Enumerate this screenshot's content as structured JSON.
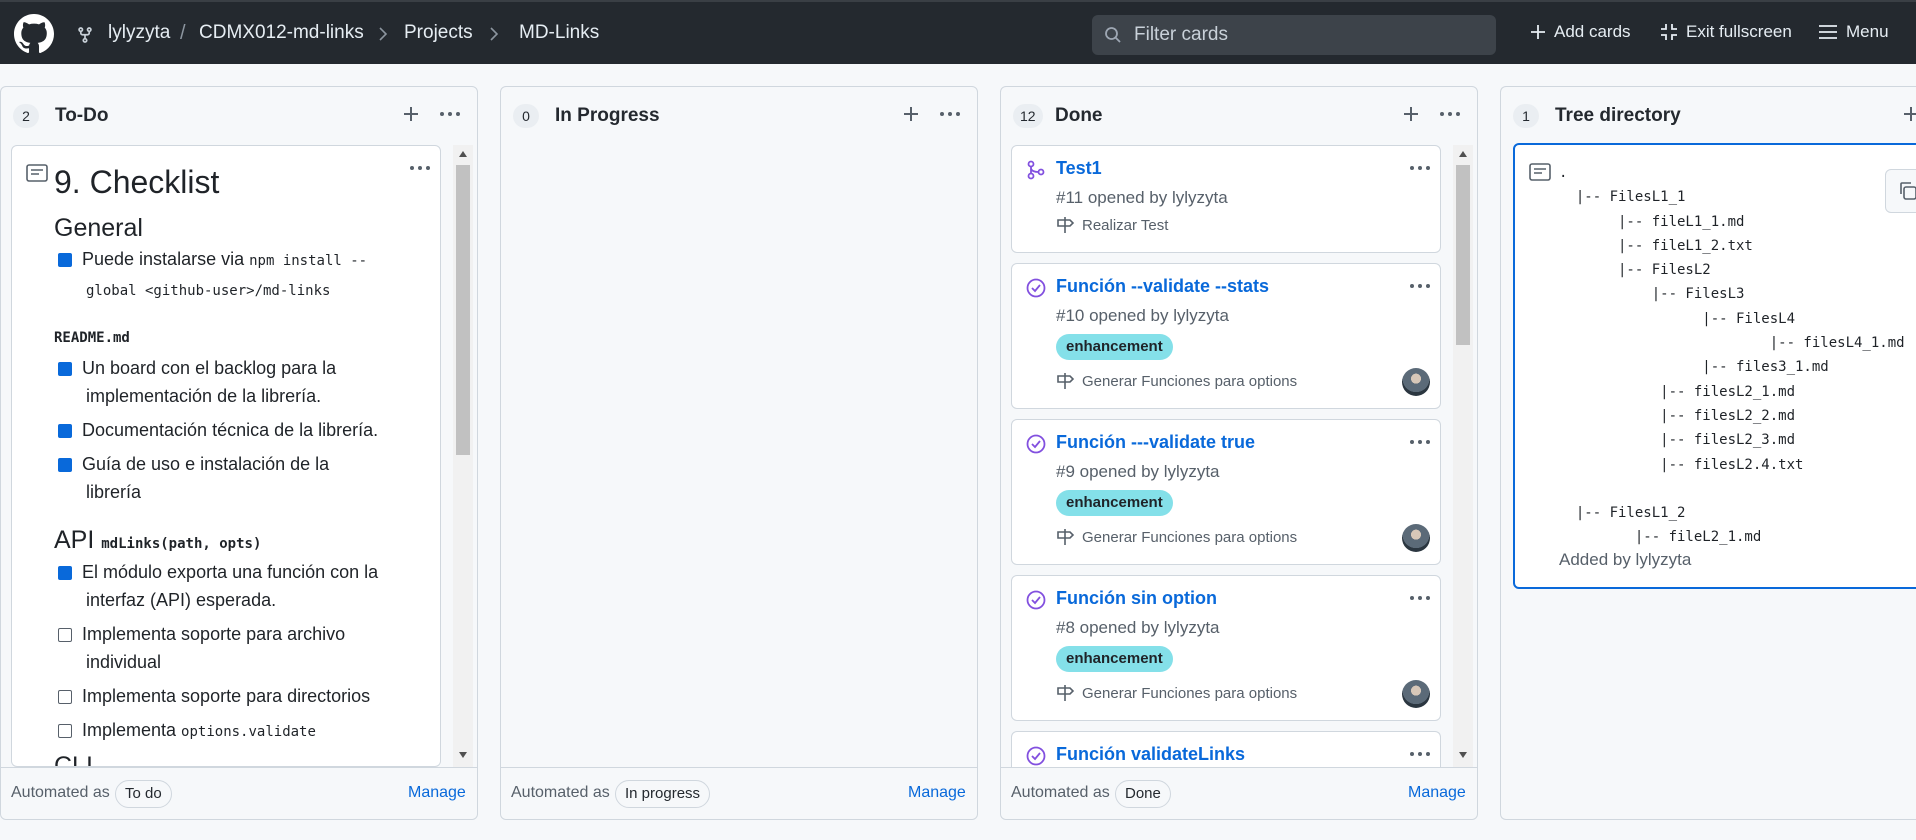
{
  "header": {
    "owner": "lylyzyta",
    "separator": "/",
    "repo": "CDMX012-md-links",
    "projects": "Projects",
    "project_name": "MD-Links",
    "filter_placeholder": "Filter cards",
    "add_cards": "Add cards",
    "exit_fullscreen": "Exit fullscreen",
    "menu": "Menu"
  },
  "columns": [
    {
      "count": "2",
      "title": "To-Do",
      "automated_as": "Automated as",
      "automation": "To do",
      "manage": "Manage"
    },
    {
      "count": "0",
      "title": "In Progress",
      "automated_as": "Automated as",
      "automation": "In progress",
      "manage": "Manage"
    },
    {
      "count": "12",
      "title": "Done",
      "automated_as": "Automated as",
      "automation": "Done",
      "manage": "Manage"
    },
    {
      "count": "1",
      "title": "Tree directory"
    }
  ],
  "todo_note": {
    "title": "9. Checklist",
    "h_general": "General",
    "item1": "Puede instalarse via ",
    "item1_code_a": "npm install --",
    "item1_code_b": "global <github-user>/md-links",
    "readme": "README.md",
    "item2a": "Un board con el backlog para la",
    "item2b": "implementación de la librería.",
    "item3": "Documentación técnica de la librería.",
    "item4a": "Guía de uso e instalación de la",
    "item4b": "librería",
    "h_api": "API",
    "api_code": "mdLinks(path, opts)",
    "item5a": "El módulo exporta una función con la",
    "item5b": "interfaz (API) esperada.",
    "item6a": "Implementa soporte para archivo",
    "item6b": "individual",
    "item7": "Implementa soporte para directorios",
    "item8": "Implementa ",
    "item8_code": "options.validate",
    "partial": "CLI"
  },
  "done_cards": [
    {
      "title": "Test1",
      "meta": "#11 opened by lylyzyta",
      "milestone": "Realizar Test"
    },
    {
      "title": "Función --validate --stats",
      "meta": "#10 opened by lylyzyta",
      "label": "enhancement",
      "milestone": "Generar Funciones para options"
    },
    {
      "title": "Función ---validate true",
      "meta": "#9 opened by lylyzyta",
      "label": "enhancement",
      "milestone": "Generar Funciones para options"
    },
    {
      "title": "Función sin option",
      "meta": "#8 opened by lylyzyta",
      "label": "enhancement",
      "milestone": "Generar Funciones para options"
    },
    {
      "title": "Función validateLinks"
    }
  ],
  "tree": {
    "content": ".\n  |-- FilesL1_1\n       |-- fileL1_1.md\n       |-- fileL1_2.txt\n       |-- FilesL2\n           |-- FilesL3\n                 |-- FilesL4\n                         |-- filesL4_1.md\n                 |-- files3_1.md\n            |-- filesL2_1.md\n            |-- filesL2_2.md\n            |-- filesL2_3.md\n            |-- filesL2.4.txt\n\n  |-- FilesL1_2\n         |-- fileL2_1.md",
    "added_by": "Added by lylyzyta"
  },
  "colors": {
    "header_bg": "#24292f",
    "link": "#0969da",
    "label_bg": "#84e0e9",
    "checkbox": "#0969da"
  }
}
